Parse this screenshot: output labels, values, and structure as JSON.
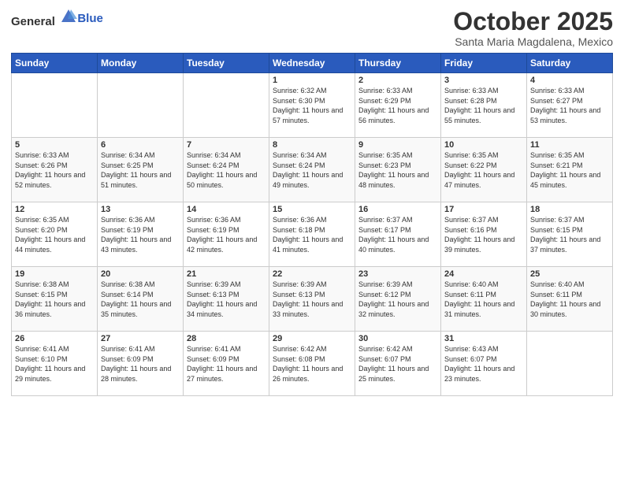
{
  "logo": {
    "general": "General",
    "blue": "Blue"
  },
  "header": {
    "month": "October 2025",
    "location": "Santa Maria Magdalena, Mexico"
  },
  "weekdays": [
    "Sunday",
    "Monday",
    "Tuesday",
    "Wednesday",
    "Thursday",
    "Friday",
    "Saturday"
  ],
  "weeks": [
    [
      {
        "day": "",
        "sunrise": "",
        "sunset": "",
        "daylight": ""
      },
      {
        "day": "",
        "sunrise": "",
        "sunset": "",
        "daylight": ""
      },
      {
        "day": "",
        "sunrise": "",
        "sunset": "",
        "daylight": ""
      },
      {
        "day": "1",
        "sunrise": "Sunrise: 6:32 AM",
        "sunset": "Sunset: 6:30 PM",
        "daylight": "Daylight: 11 hours and 57 minutes."
      },
      {
        "day": "2",
        "sunrise": "Sunrise: 6:33 AM",
        "sunset": "Sunset: 6:29 PM",
        "daylight": "Daylight: 11 hours and 56 minutes."
      },
      {
        "day": "3",
        "sunrise": "Sunrise: 6:33 AM",
        "sunset": "Sunset: 6:28 PM",
        "daylight": "Daylight: 11 hours and 55 minutes."
      },
      {
        "day": "4",
        "sunrise": "Sunrise: 6:33 AM",
        "sunset": "Sunset: 6:27 PM",
        "daylight": "Daylight: 11 hours and 53 minutes."
      }
    ],
    [
      {
        "day": "5",
        "sunrise": "Sunrise: 6:33 AM",
        "sunset": "Sunset: 6:26 PM",
        "daylight": "Daylight: 11 hours and 52 minutes."
      },
      {
        "day": "6",
        "sunrise": "Sunrise: 6:34 AM",
        "sunset": "Sunset: 6:25 PM",
        "daylight": "Daylight: 11 hours and 51 minutes."
      },
      {
        "day": "7",
        "sunrise": "Sunrise: 6:34 AM",
        "sunset": "Sunset: 6:24 PM",
        "daylight": "Daylight: 11 hours and 50 minutes."
      },
      {
        "day": "8",
        "sunrise": "Sunrise: 6:34 AM",
        "sunset": "Sunset: 6:24 PM",
        "daylight": "Daylight: 11 hours and 49 minutes."
      },
      {
        "day": "9",
        "sunrise": "Sunrise: 6:35 AM",
        "sunset": "Sunset: 6:23 PM",
        "daylight": "Daylight: 11 hours and 48 minutes."
      },
      {
        "day": "10",
        "sunrise": "Sunrise: 6:35 AM",
        "sunset": "Sunset: 6:22 PM",
        "daylight": "Daylight: 11 hours and 47 minutes."
      },
      {
        "day": "11",
        "sunrise": "Sunrise: 6:35 AM",
        "sunset": "Sunset: 6:21 PM",
        "daylight": "Daylight: 11 hours and 45 minutes."
      }
    ],
    [
      {
        "day": "12",
        "sunrise": "Sunrise: 6:35 AM",
        "sunset": "Sunset: 6:20 PM",
        "daylight": "Daylight: 11 hours and 44 minutes."
      },
      {
        "day": "13",
        "sunrise": "Sunrise: 6:36 AM",
        "sunset": "Sunset: 6:19 PM",
        "daylight": "Daylight: 11 hours and 43 minutes."
      },
      {
        "day": "14",
        "sunrise": "Sunrise: 6:36 AM",
        "sunset": "Sunset: 6:19 PM",
        "daylight": "Daylight: 11 hours and 42 minutes."
      },
      {
        "day": "15",
        "sunrise": "Sunrise: 6:36 AM",
        "sunset": "Sunset: 6:18 PM",
        "daylight": "Daylight: 11 hours and 41 minutes."
      },
      {
        "day": "16",
        "sunrise": "Sunrise: 6:37 AM",
        "sunset": "Sunset: 6:17 PM",
        "daylight": "Daylight: 11 hours and 40 minutes."
      },
      {
        "day": "17",
        "sunrise": "Sunrise: 6:37 AM",
        "sunset": "Sunset: 6:16 PM",
        "daylight": "Daylight: 11 hours and 39 minutes."
      },
      {
        "day": "18",
        "sunrise": "Sunrise: 6:37 AM",
        "sunset": "Sunset: 6:15 PM",
        "daylight": "Daylight: 11 hours and 37 minutes."
      }
    ],
    [
      {
        "day": "19",
        "sunrise": "Sunrise: 6:38 AM",
        "sunset": "Sunset: 6:15 PM",
        "daylight": "Daylight: 11 hours and 36 minutes."
      },
      {
        "day": "20",
        "sunrise": "Sunrise: 6:38 AM",
        "sunset": "Sunset: 6:14 PM",
        "daylight": "Daylight: 11 hours and 35 minutes."
      },
      {
        "day": "21",
        "sunrise": "Sunrise: 6:39 AM",
        "sunset": "Sunset: 6:13 PM",
        "daylight": "Daylight: 11 hours and 34 minutes."
      },
      {
        "day": "22",
        "sunrise": "Sunrise: 6:39 AM",
        "sunset": "Sunset: 6:13 PM",
        "daylight": "Daylight: 11 hours and 33 minutes."
      },
      {
        "day": "23",
        "sunrise": "Sunrise: 6:39 AM",
        "sunset": "Sunset: 6:12 PM",
        "daylight": "Daylight: 11 hours and 32 minutes."
      },
      {
        "day": "24",
        "sunrise": "Sunrise: 6:40 AM",
        "sunset": "Sunset: 6:11 PM",
        "daylight": "Daylight: 11 hours and 31 minutes."
      },
      {
        "day": "25",
        "sunrise": "Sunrise: 6:40 AM",
        "sunset": "Sunset: 6:11 PM",
        "daylight": "Daylight: 11 hours and 30 minutes."
      }
    ],
    [
      {
        "day": "26",
        "sunrise": "Sunrise: 6:41 AM",
        "sunset": "Sunset: 6:10 PM",
        "daylight": "Daylight: 11 hours and 29 minutes."
      },
      {
        "day": "27",
        "sunrise": "Sunrise: 6:41 AM",
        "sunset": "Sunset: 6:09 PM",
        "daylight": "Daylight: 11 hours and 28 minutes."
      },
      {
        "day": "28",
        "sunrise": "Sunrise: 6:41 AM",
        "sunset": "Sunset: 6:09 PM",
        "daylight": "Daylight: 11 hours and 27 minutes."
      },
      {
        "day": "29",
        "sunrise": "Sunrise: 6:42 AM",
        "sunset": "Sunset: 6:08 PM",
        "daylight": "Daylight: 11 hours and 26 minutes."
      },
      {
        "day": "30",
        "sunrise": "Sunrise: 6:42 AM",
        "sunset": "Sunset: 6:07 PM",
        "daylight": "Daylight: 11 hours and 25 minutes."
      },
      {
        "day": "31",
        "sunrise": "Sunrise: 6:43 AM",
        "sunset": "Sunset: 6:07 PM",
        "daylight": "Daylight: 11 hours and 23 minutes."
      },
      {
        "day": "",
        "sunrise": "",
        "sunset": "",
        "daylight": ""
      }
    ]
  ]
}
